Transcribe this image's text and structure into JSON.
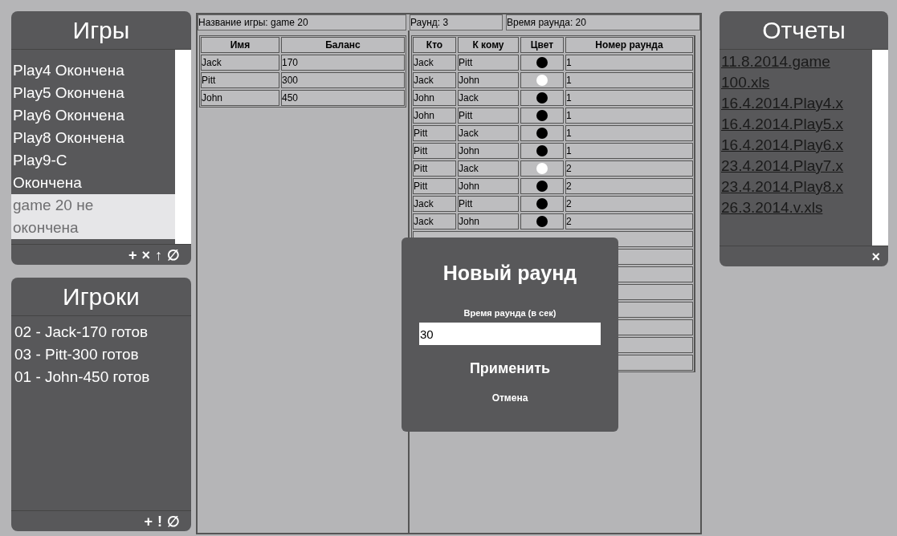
{
  "games": {
    "title": "Игры",
    "items": [
      {
        "label": "Play4 Окончена",
        "selected": false
      },
      {
        "label": "Play5 Окончена",
        "selected": false
      },
      {
        "label": "Play6 Окончена",
        "selected": false
      },
      {
        "label": "Play8 Окончена",
        "selected": false
      },
      {
        "label": "Play9-C\nОкончена",
        "selected": false
      },
      {
        "label": "game 20 не\nокончена",
        "selected": true
      }
    ],
    "actions": [
      "+",
      "×",
      "↑",
      "∅"
    ]
  },
  "players": {
    "title": "Игроки",
    "items": [
      "02 - Jack-170 готов",
      "03 - Pitt-300 готов",
      "01 - John-450 готов"
    ],
    "actions": [
      "+",
      "!",
      "∅"
    ]
  },
  "info": {
    "game_name": "Название игры: game 20",
    "round": "Раунд: 3",
    "round_time": "Время раунда: 20"
  },
  "balance_table": {
    "columns": [
      "Имя",
      "Баланс"
    ],
    "rows": [
      [
        "Jack",
        "170"
      ],
      [
        "Pitt",
        "300"
      ],
      [
        "John",
        "450"
      ]
    ]
  },
  "moves_table": {
    "columns": [
      "Кто",
      "К кому",
      "Цвет",
      "Номер раунда"
    ],
    "rows": [
      {
        "from": "Jack",
        "to": "Pitt",
        "color": "#000000",
        "round": "1"
      },
      {
        "from": "Jack",
        "to": "John",
        "color": "#ffffff",
        "round": "1"
      },
      {
        "from": "John",
        "to": "Jack",
        "color": "#000000",
        "round": "1"
      },
      {
        "from": "John",
        "to": "Pitt",
        "color": "#000000",
        "round": "1"
      },
      {
        "from": "Pitt",
        "to": "Jack",
        "color": "#000000",
        "round": "1"
      },
      {
        "from": "Pitt",
        "to": "John",
        "color": "#000000",
        "round": "1"
      },
      {
        "from": "Pitt",
        "to": "Jack",
        "color": "#ffffff",
        "round": "2"
      },
      {
        "from": "Pitt",
        "to": "John",
        "color": "#000000",
        "round": "2"
      },
      {
        "from": "Jack",
        "to": "Pitt",
        "color": "#000000",
        "round": "2"
      },
      {
        "from": "Jack",
        "to": "John",
        "color": "#000000",
        "round": "2"
      }
    ]
  },
  "dialog": {
    "title": "Новый раунд",
    "field_label": "Время раунда (в сек)",
    "value": "30",
    "apply": "Применить",
    "cancel": "Отмена"
  },
  "reports": {
    "title": "Отчеты",
    "items": [
      "11.8.2014.game\n100.xls",
      "16.4.2014.Play4.x",
      "16.4.2014.Play5.x",
      "16.4.2014.Play6.x",
      "23.4.2014.Play7.x",
      "23.4.2014.Play8.x",
      "26.3.2014.v.xls"
    ],
    "actions": [
      "×"
    ]
  }
}
